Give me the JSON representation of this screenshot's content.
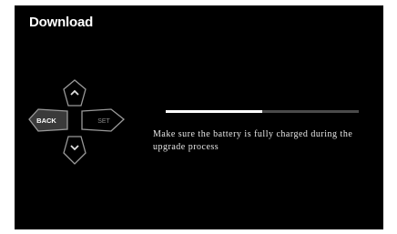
{
  "screen": {
    "title": "Download",
    "message": "Make sure the battery is fully charged during the upgrade process"
  },
  "dpad": {
    "back_label": "BACK",
    "set_label": "SET",
    "up_icon": "chevron-up-icon",
    "down_icon": "chevron-down-icon"
  },
  "progress": {
    "fraction": 0.5
  },
  "colors": {
    "background": "#000000",
    "text": "#ffffff",
    "button_outline": "#9a9a9a",
    "back_fill": "#3a3a3a",
    "progress_fill": "#ffffff",
    "progress_track": "#4a4a4a"
  }
}
